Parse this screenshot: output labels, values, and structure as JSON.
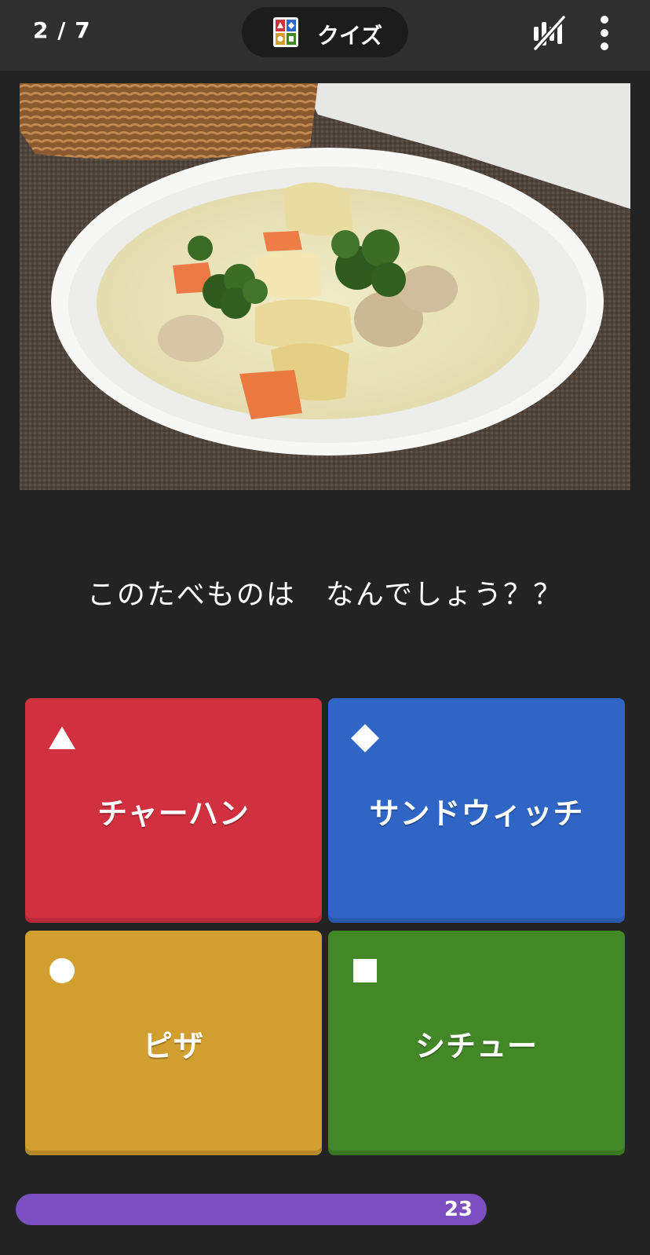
{
  "header": {
    "progress": "2 / 7",
    "mode_label": "クイズ",
    "icons": [
      "quiz-card-icon",
      "audio-off-icon",
      "more-vert-icon"
    ]
  },
  "question": {
    "image_icon": "cream-stew-photo",
    "text": "このたべものは　なんでしょう？？"
  },
  "answers": [
    {
      "label": "チャーハン",
      "shape": "triangle",
      "color": "#d1303f"
    },
    {
      "label": "サンドウィッチ",
      "shape": "diamond",
      "color": "#2f66c6"
    },
    {
      "label": "ピザ",
      "shape": "circle",
      "color": "#d19f2f"
    },
    {
      "label": "シチュー",
      "shape": "square",
      "color": "#438826"
    }
  ],
  "timer": {
    "value": "23",
    "color": "#7b4fbf"
  }
}
